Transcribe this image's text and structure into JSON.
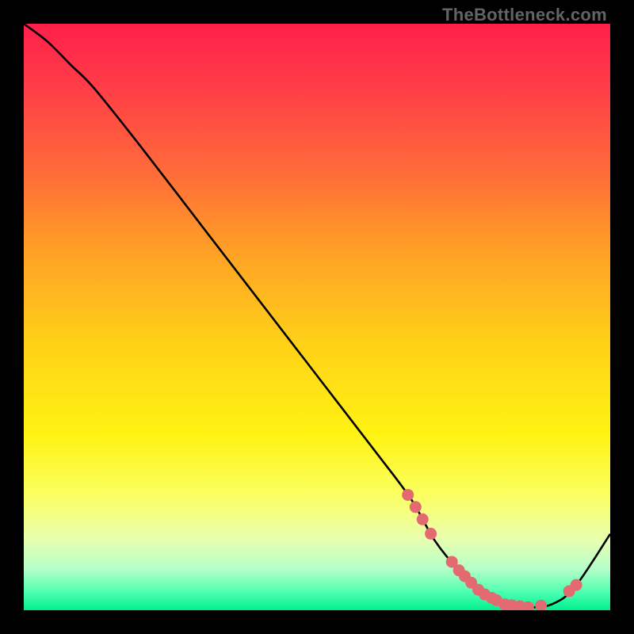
{
  "watermark": "TheBottleneck.com",
  "chart_data": {
    "type": "line",
    "title": "",
    "xlabel": "",
    "ylabel": "",
    "xlim": [
      0,
      100
    ],
    "ylim": [
      0,
      100
    ],
    "series": [
      {
        "name": "curve",
        "x": [
          0,
          4,
          8,
          12,
          20,
          30,
          40,
          50,
          60,
          66,
          70,
          74,
          78,
          82,
          86,
          90,
          94,
          100
        ],
        "y": [
          100,
          97,
          93,
          89,
          79,
          66,
          53,
          40,
          27,
          19,
          12,
          7,
          3,
          1,
          0.5,
          1,
          4,
          13
        ]
      }
    ],
    "dots_x": [
      65.5,
      66.8,
      68.0,
      69.4,
      73.0,
      74.2,
      75.2,
      76.3,
      77.5,
      78.6,
      79.8,
      80.6,
      82.0,
      83.2,
      84.6,
      86.0,
      88.2,
      93.0,
      94.2
    ],
    "gradient_note": "background encodes performance: top red = bad, bottom green = good"
  }
}
